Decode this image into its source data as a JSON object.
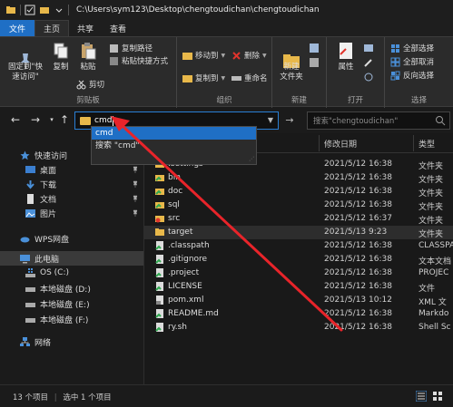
{
  "window": {
    "title": "C:\\Users\\sym123\\Desktop\\chengtoudichan\\chengtoudichan"
  },
  "ribbon": {
    "tabs": [
      "文件",
      "主页",
      "共享",
      "查看"
    ],
    "clipboard": {
      "pin_quick_access": "固定到\"快\n速访问\"",
      "copy": "复制",
      "paste": "粘贴",
      "copy_path": "复制路径",
      "paste_shortcut": "粘贴快捷方式",
      "cut": "剪切",
      "label": "剪贴板"
    },
    "organize": {
      "move_to": "移动到",
      "copy_to": "复制到",
      "delete": "删除",
      "rename": "重命名",
      "label": "组织"
    },
    "new": {
      "new_folder": "新建\n文件夹",
      "label": "新建"
    },
    "open": {
      "properties": "属性",
      "label": "打开"
    },
    "select": {
      "select_all": "全部选择",
      "select_none": "全部取消",
      "invert": "反向选择",
      "label": "选择"
    }
  },
  "address": {
    "value": "cmd",
    "search_placeholder": "搜索\"chengtoudichan\""
  },
  "autocomplete": {
    "items": [
      "cmd",
      "搜索 \"cmd\""
    ]
  },
  "nav": {
    "items": [
      {
        "label": "快速访问"
      },
      {
        "label": "桌面"
      },
      {
        "label": "下载"
      },
      {
        "label": "文档"
      },
      {
        "label": "图片"
      },
      {
        "label": "WPS网盘"
      },
      {
        "label": "此电脑"
      },
      {
        "label": "OS (C:)"
      },
      {
        "label": "本地磁盘 (D:)"
      },
      {
        "label": "本地磁盘 (E:)"
      },
      {
        "label": "本地磁盘 (F:)"
      },
      {
        "label": "网络"
      }
    ]
  },
  "files": {
    "headers": {
      "name": "名称",
      "date": "修改日期",
      "type": "类型"
    },
    "rows": [
      {
        "name": ".settings",
        "date": "2021/5/12 16:38",
        "type": "文件夹",
        "kind": "folder"
      },
      {
        "name": "bin",
        "date": "2021/5/12 16:38",
        "type": "文件夹",
        "kind": "folder-green"
      },
      {
        "name": "doc",
        "date": "2021/5/12 16:38",
        "type": "文件夹",
        "kind": "folder-green"
      },
      {
        "name": "sql",
        "date": "2021/5/12 16:38",
        "type": "文件夹",
        "kind": "folder-green"
      },
      {
        "name": "src",
        "date": "2021/5/12 16:37",
        "type": "文件夹",
        "kind": "folder-red"
      },
      {
        "name": "target",
        "date": "2021/5/13 9:23",
        "type": "文件夹",
        "kind": "folder"
      },
      {
        "name": ".classpath",
        "date": "2021/5/12 16:38",
        "type": "CLASSPA",
        "kind": "file-green"
      },
      {
        "name": ".gitignore",
        "date": "2021/5/12 16:38",
        "type": "文本文档",
        "kind": "file-green"
      },
      {
        "name": ".project",
        "date": "2021/5/12 16:38",
        "type": "PROJEC",
        "kind": "file-green"
      },
      {
        "name": "LICENSE",
        "date": "2021/5/12 16:38",
        "type": "文件",
        "kind": "file-green"
      },
      {
        "name": "pom.xml",
        "date": "2021/5/13 10:12",
        "type": "XML 文",
        "kind": "file-gray"
      },
      {
        "name": "README.md",
        "date": "2021/5/12 16:38",
        "type": "Markdo",
        "kind": "file-green"
      },
      {
        "name": "ry.sh",
        "date": "2021/5/12 16:38",
        "type": "Shell Sc",
        "kind": "file-green"
      }
    ]
  },
  "status": {
    "count": "13 个项目",
    "selected": "选中 1 个项目"
  },
  "colors": {
    "accent": "#1f6fc5",
    "annotation_arrow": "#e8242a"
  }
}
